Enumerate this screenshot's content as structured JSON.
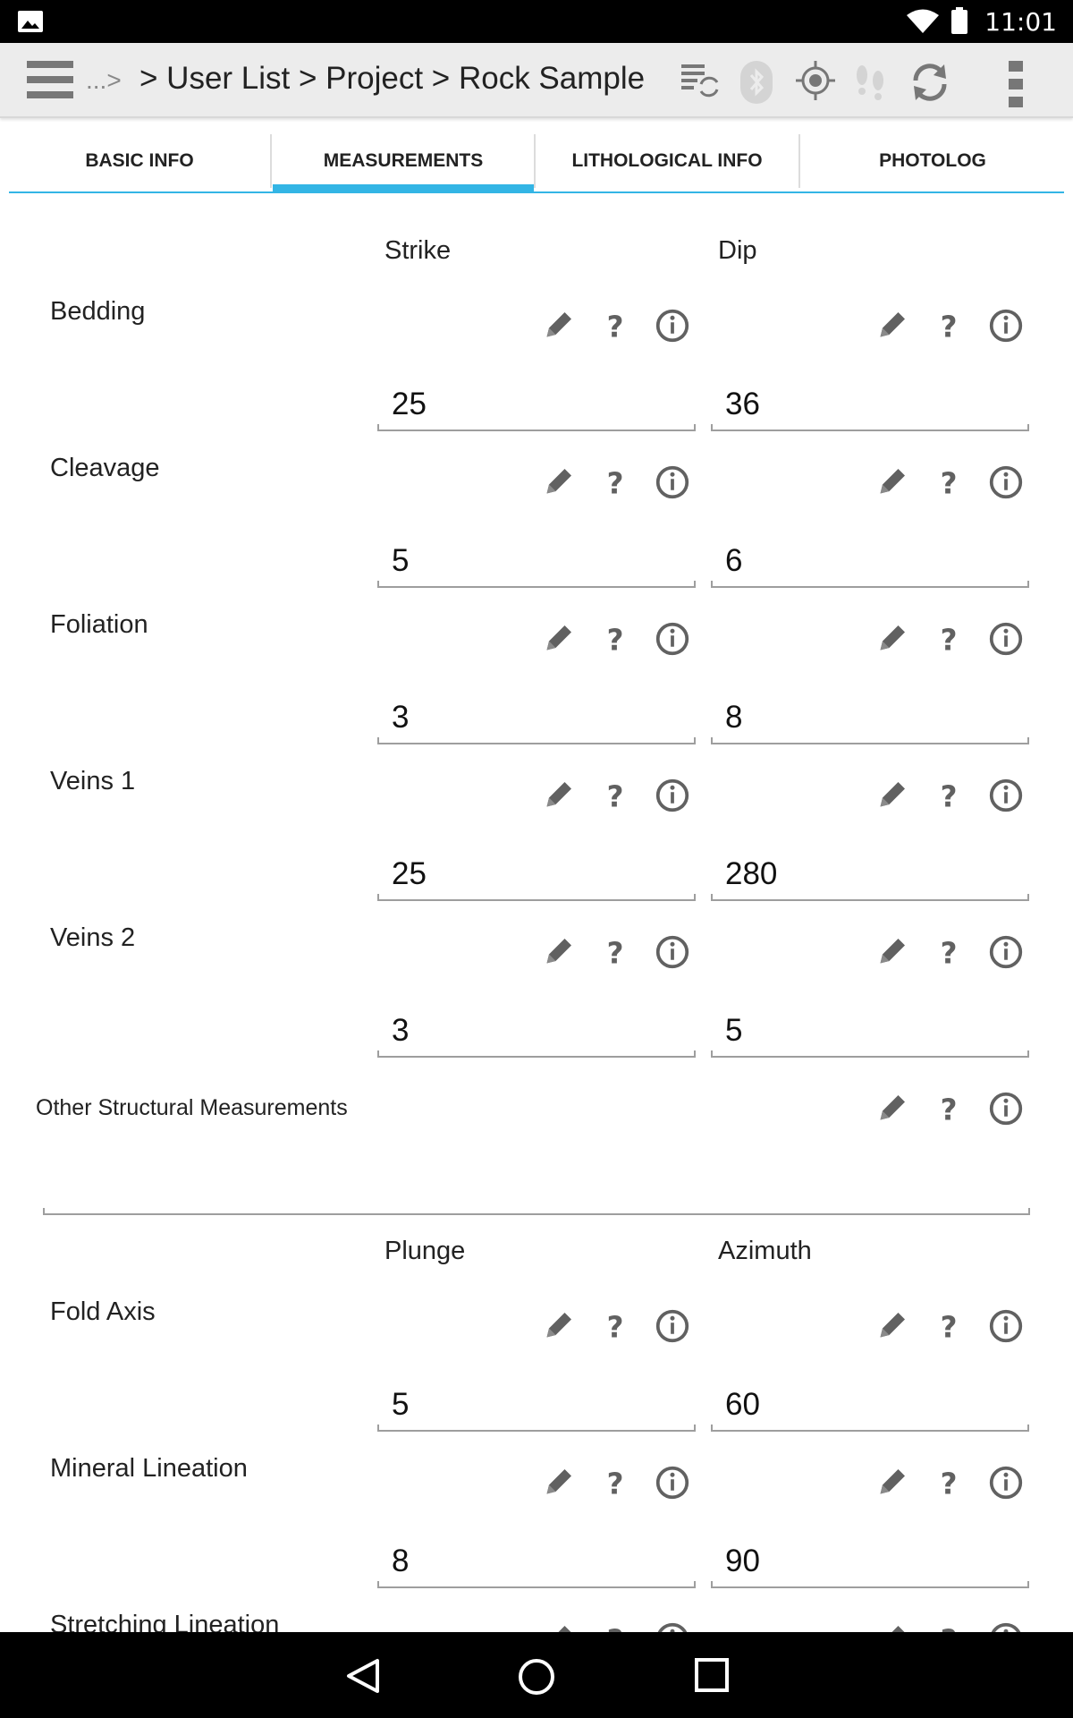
{
  "status_bar": {
    "time": "11:01"
  },
  "toolbar": {
    "crumb_more": "...>",
    "breadcrumb": "> User List > Project > Rock Sample"
  },
  "tabs": [
    {
      "label": "BASIC INFO",
      "active": false
    },
    {
      "label": "MEASUREMENTS",
      "active": true
    },
    {
      "label": "LITHOLOGICAL INFO",
      "active": false
    },
    {
      "label": "PHOTOLOG",
      "active": false
    }
  ],
  "headers": {
    "strike": "Strike",
    "dip": "Dip",
    "plunge": "Plunge",
    "azimuth": "Azimuth"
  },
  "rows": [
    {
      "label": "Bedding",
      "left": "25",
      "right": "36"
    },
    {
      "label": "Cleavage",
      "left": "5",
      "right": "6"
    },
    {
      "label": "Foliation",
      "left": "3",
      "right": "8"
    },
    {
      "label": "Veins 1",
      "left": "25",
      "right": "280"
    },
    {
      "label": "Veins 2",
      "left": "3",
      "right": "5"
    }
  ],
  "other": {
    "label": "Other Structural Measurements",
    "value": ""
  },
  "rows2": [
    {
      "label": "Fold Axis",
      "left": "5",
      "right": "60"
    },
    {
      "label": "Mineral Lineation",
      "left": "8",
      "right": "90"
    },
    {
      "label": "Stretching Lineation",
      "left": "",
      "right": ""
    }
  ],
  "colors": {
    "accent": "#33b5e5",
    "icon": "#616161"
  }
}
